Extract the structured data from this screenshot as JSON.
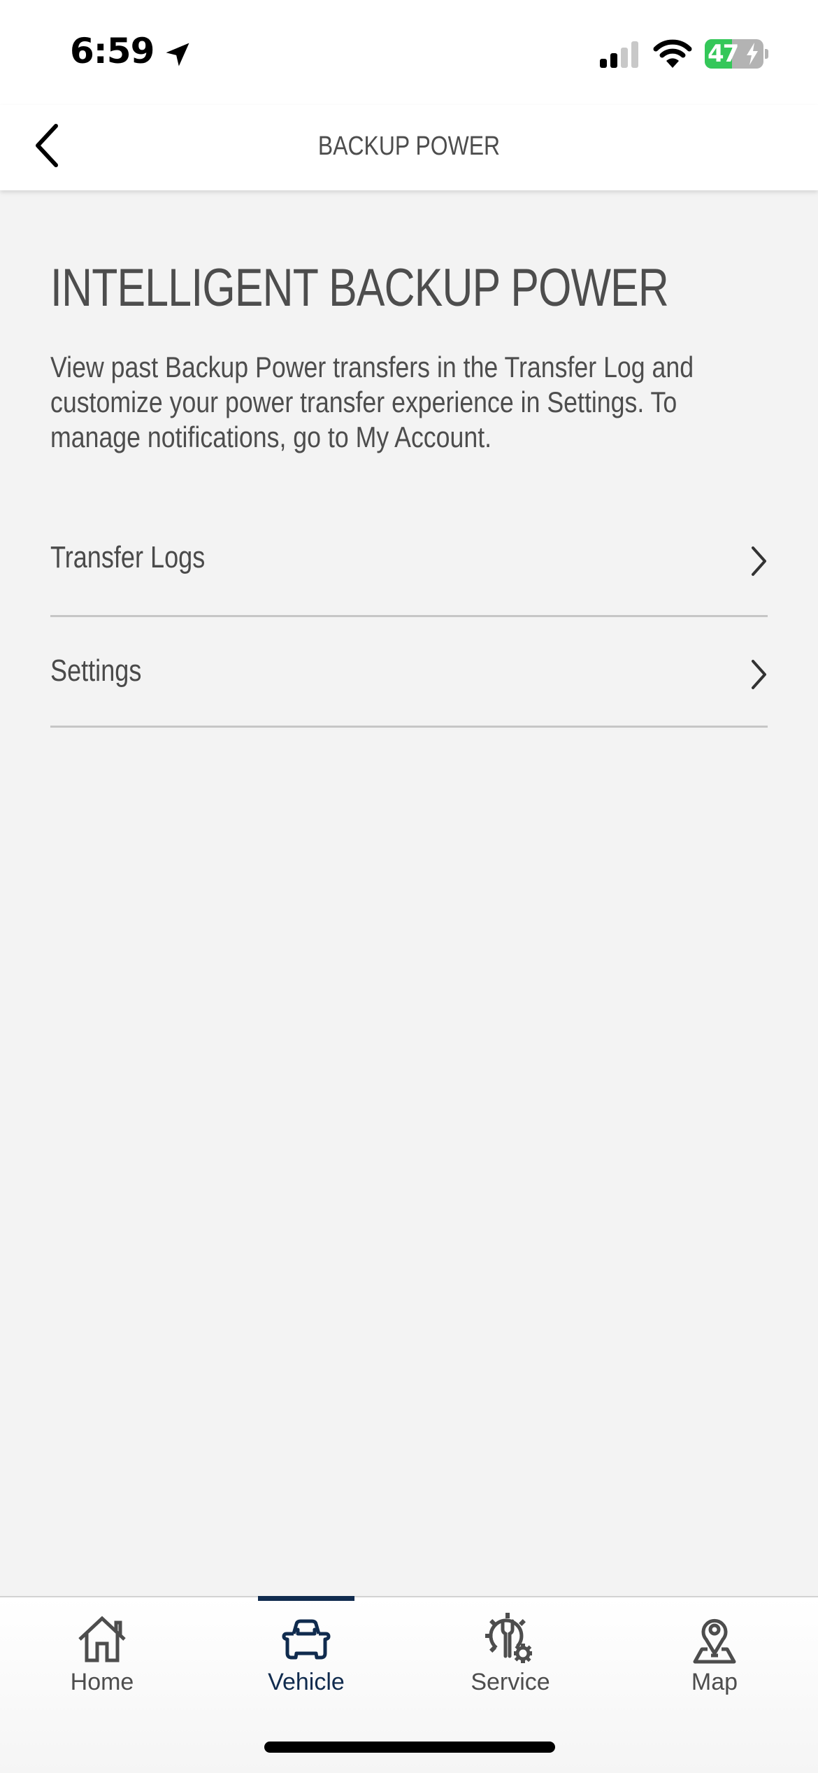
{
  "status_bar": {
    "time": "6:59",
    "location_icon": "location-arrow-icon",
    "signal_icon": "cellular-signal-icon",
    "signal_bars_active": 2,
    "signal_bars_total": 4,
    "wifi_icon": "wifi-icon",
    "battery_percent": "47",
    "battery_level": 0.47,
    "battery_charging": true
  },
  "header": {
    "back_icon": "chevron-left-icon",
    "title": "BACKUP POWER"
  },
  "main": {
    "title": "INTELLIGENT BACKUP POWER",
    "description": "View past Backup Power transfers in the Transfer Log and customize your power transfer experience in Settings. To manage notifications, go to My Account.",
    "items": [
      {
        "label": "Transfer Logs",
        "icon": "chevron-right-icon"
      },
      {
        "label": "Settings",
        "icon": "chevron-right-icon"
      }
    ]
  },
  "bottom_nav": {
    "active": "Vehicle",
    "items": [
      {
        "label": "Home",
        "icon": "home-icon"
      },
      {
        "label": "Vehicle",
        "icon": "car-icon"
      },
      {
        "label": "Service",
        "icon": "service-gear-wrench-icon"
      },
      {
        "label": "Map",
        "icon": "map-pin-icon"
      }
    ]
  },
  "colors": {
    "accent": "#102b4e",
    "text": "#4d4d4d",
    "background": "#f3f3f3",
    "battery_green": "#34c759"
  }
}
